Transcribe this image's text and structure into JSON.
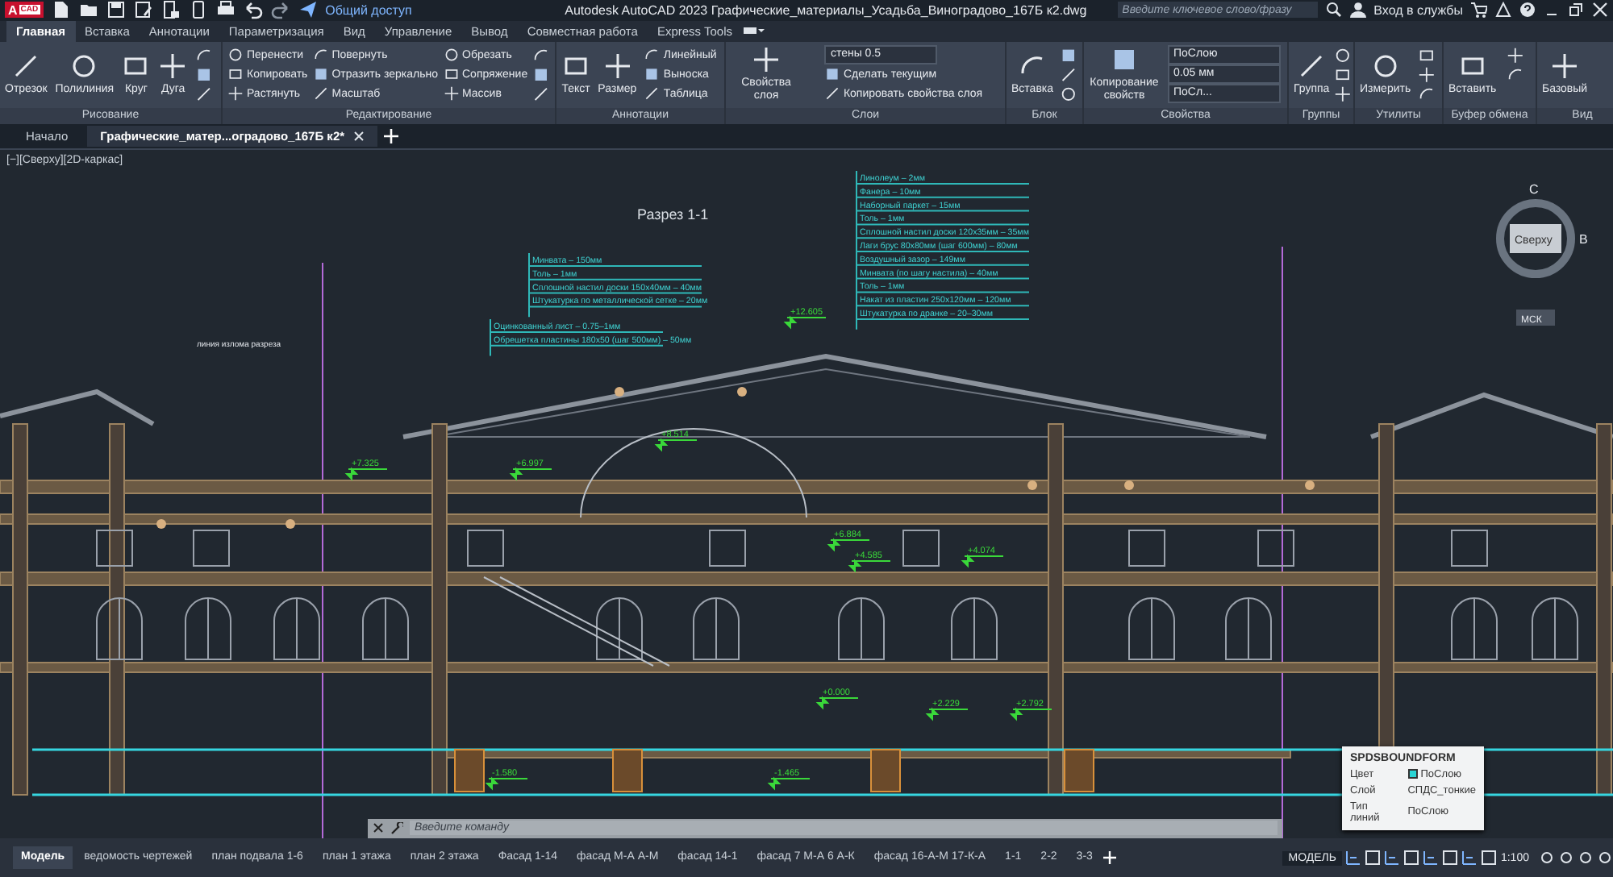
{
  "app": {
    "logo": "A",
    "badge": "CAD",
    "share_label": "Общий доступ",
    "title": "Autodesk AutoCAD 2023",
    "file_name": "Графические_материалы_Усадьба_Виноградово_167Б к2.dwg"
  },
  "search": {
    "placeholder": "Введите ключевое слово/фразу"
  },
  "sign_in": "Вход в службы",
  "ribbon_tabs": [
    {
      "label": "Главная",
      "selected": true
    },
    {
      "label": "Вставка",
      "selected": false
    },
    {
      "label": "Аннотации",
      "selected": false
    },
    {
      "label": "Параметризация",
      "selected": false
    },
    {
      "label": "Вид",
      "selected": false
    },
    {
      "label": "Управление",
      "selected": false
    },
    {
      "label": "Вывод",
      "selected": false
    },
    {
      "label": "Совместная работа",
      "selected": false
    },
    {
      "label": "Express Tools",
      "selected": false
    }
  ],
  "panels": [
    {
      "title": "Рисование",
      "tools": [
        {
          "kind": "large",
          "label": "Отрезок"
        },
        {
          "kind": "large",
          "label": "Полилиния"
        },
        {
          "kind": "large",
          "label": "Круг"
        },
        {
          "kind": "large",
          "label": "Дуга"
        },
        {
          "kind": "icon"
        },
        {
          "kind": "icon"
        },
        {
          "kind": "icon"
        }
      ]
    },
    {
      "title": "Редактирование",
      "tools": [
        {
          "kind": "small",
          "label": "Перенести"
        },
        {
          "kind": "small",
          "label": "Копировать"
        },
        {
          "kind": "small",
          "label": "Растянуть"
        },
        {
          "kind": "small",
          "label": "Повернуть"
        },
        {
          "kind": "small",
          "label": "Отразить зеркально"
        },
        {
          "kind": "small",
          "label": "Масштаб"
        },
        {
          "kind": "small",
          "label": "Обрезать"
        },
        {
          "kind": "small",
          "label": "Сопряжение"
        },
        {
          "kind": "small",
          "label": "Массив"
        },
        {
          "kind": "icon"
        },
        {
          "kind": "icon"
        },
        {
          "kind": "icon"
        }
      ]
    },
    {
      "title": "Аннотации",
      "tools": [
        {
          "kind": "large",
          "label": "Текст"
        },
        {
          "kind": "large",
          "label": "Размер"
        },
        {
          "kind": "small",
          "label": "Линейный"
        },
        {
          "kind": "small",
          "label": "Выноска"
        },
        {
          "kind": "small",
          "label": "Таблица"
        }
      ]
    },
    {
      "title": "Слои",
      "tools": [
        {
          "kind": "large",
          "label": "Свойства слоя"
        },
        {
          "kind": "dropdown",
          "label": "стены 0.5"
        },
        {
          "kind": "small",
          "label": "Сделать текущим"
        },
        {
          "kind": "small",
          "label": "Копировать свойства слоя"
        }
      ]
    },
    {
      "title": "Блок",
      "tools": [
        {
          "kind": "large",
          "label": "Вставка"
        },
        {
          "kind": "icon"
        },
        {
          "kind": "icon"
        },
        {
          "kind": "icon"
        }
      ]
    },
    {
      "title": "Свойства",
      "tools": [
        {
          "kind": "large",
          "label": "Копирование свойств"
        },
        {
          "kind": "dropdown",
          "label": "ПоСлою"
        },
        {
          "kind": "dropdown",
          "label": "0.05 мм"
        },
        {
          "kind": "dropdown",
          "label": "ПоСл..."
        }
      ]
    },
    {
      "title": "Группы",
      "tools": [
        {
          "kind": "large",
          "label": "Группа"
        },
        {
          "kind": "icon"
        },
        {
          "kind": "icon"
        },
        {
          "kind": "icon"
        }
      ]
    },
    {
      "title": "Утилиты",
      "tools": [
        {
          "kind": "large",
          "label": "Измерить"
        },
        {
          "kind": "icon"
        },
        {
          "kind": "icon"
        },
        {
          "kind": "icon"
        }
      ]
    },
    {
      "title": "Буфер обмена",
      "tools": [
        {
          "kind": "large",
          "label": "Вставить"
        },
        {
          "kind": "icon"
        },
        {
          "kind": "icon"
        }
      ]
    },
    {
      "title": "Вид",
      "tools": [
        {
          "kind": "large",
          "label": "Базовый"
        }
      ]
    }
  ],
  "doc_tabs": [
    {
      "label": "Начало",
      "selected": false
    },
    {
      "label": "Графические_матер...оградово_167Б к2*",
      "selected": true
    }
  ],
  "viewport": {
    "label": "[−][Сверху][2D-каркас]",
    "section_title": "Разрез 1-1",
    "break_label": "линия излома разреза",
    "viewcube": {
      "north": "С",
      "east": "В",
      "face": "Сверху",
      "ucs": "МСК"
    },
    "callouts": [
      {
        "lines": [
          "Минвата – 150мм",
          "Толь – 1мм",
          "Сплошной настил доски 150х40мм – 40мм",
          "Штукатурка по металлической сетке – 20мм"
        ]
      },
      {
        "lines": [
          "Оцинкованный лист – 0.75–1мм",
          "Обрешетка пластины 180х50 (шаг 500мм) – 50мм"
        ]
      },
      {
        "lines": [
          "Линолеум – 2мм",
          "Фанера – 10мм",
          "Наборный паркет – 15мм",
          "Толь – 1мм",
          "Сплошной настил доски 120х35мм – 35мм",
          "Лаги брус 80х80мм (шаг 600мм) – 80мм",
          "Воздушный зазор – 149мм",
          "Минвата (по шагу настила) – 40мм",
          "Толь – 1мм",
          "Накат из пластин 250х120мм – 120мм",
          "Штукатурка по дранке – 20–30мм"
        ]
      }
    ],
    "elevations": [
      "+12.605",
      "+8.514",
      "+7.325",
      "+6.997",
      "+6.884",
      "+4.585",
      "+4.074",
      "+2.229",
      "+2.792",
      "+0.000",
      "-1.580",
      "-1.465"
    ]
  },
  "command": {
    "placeholder": "Введите команду"
  },
  "tooltip": {
    "title": "SPDSBOUNDFORM",
    "rows": [
      {
        "kind": "color",
        "key": "Цвет",
        "value": "ПоСлою"
      },
      {
        "kind": "text",
        "key": "Слой",
        "value": "СПДС_тонкие"
      },
      {
        "kind": "text",
        "key": "Тип линий",
        "value": "ПоСлою"
      }
    ]
  },
  "layout_tabs": [
    {
      "label": "Модель",
      "selected": true
    },
    {
      "label": "ведомость чертежей",
      "selected": false
    },
    {
      "label": "план подвала 1-6",
      "selected": false
    },
    {
      "label": "план 1 этажа",
      "selected": false
    },
    {
      "label": "план 2 этажа",
      "selected": false
    },
    {
      "label": "Фасад 1-14",
      "selected": false
    },
    {
      "label": "фасад М-А  А-М",
      "selected": false
    },
    {
      "label": "фасад 14-1",
      "selected": false
    },
    {
      "label": "фасад  7 М-А 6 А-К",
      "selected": false
    },
    {
      "label": "фасад 16-А-М 17-К-А",
      "selected": false
    },
    {
      "label": "1-1",
      "selected": false
    },
    {
      "label": "2-2",
      "selected": false
    },
    {
      "label": "3-3",
      "selected": false
    }
  ],
  "status": {
    "space": "МОДЕЛЬ",
    "scale": "1:100"
  }
}
